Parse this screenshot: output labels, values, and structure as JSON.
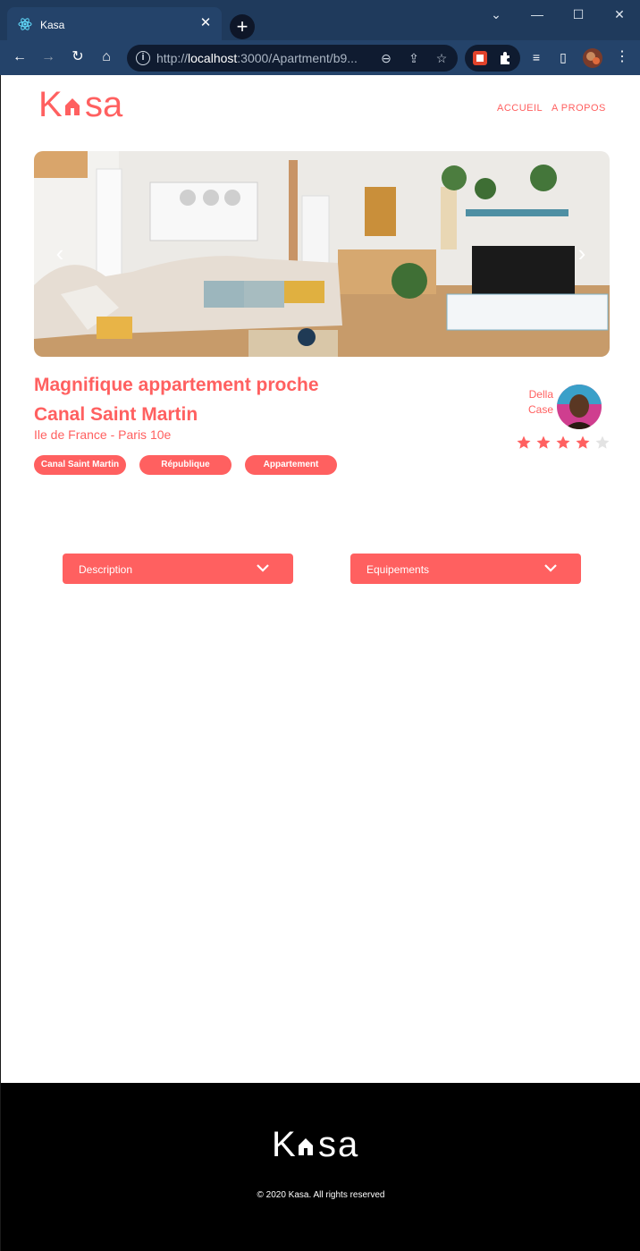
{
  "browser": {
    "tab_title": "Kasa",
    "tab_close": "✕",
    "new_tab": "+",
    "url_host": "localhost",
    "url_prefix": "http://",
    "url_rest": ":3000/Apartment/b9...",
    "window_controls": [
      "⌄",
      "—",
      "☐",
      "✕"
    ]
  },
  "header": {
    "logo_text": "K  sa",
    "nav": [
      "ACCUEIL",
      "A PROPOS"
    ]
  },
  "listing": {
    "title": "Magnifique appartement proche Canal Saint Martin",
    "location": "Ile de France - Paris 10e",
    "tags": [
      "Canal Saint Martin",
      "République",
      "Appartement"
    ],
    "host_first": "Della",
    "host_last": "Case",
    "rating": 4,
    "rating_max": 5
  },
  "gallery": {
    "prev": "‹",
    "next": "›"
  },
  "collapses": [
    "Description",
    "Equipements"
  ],
  "footer": {
    "logo_text": "K  sa",
    "copyright": "© 2020 Kasa. All rights reserved"
  },
  "colors": {
    "brand": "#ff6060",
    "chrome": "#24436a",
    "star_off": "#e3e3e3"
  }
}
